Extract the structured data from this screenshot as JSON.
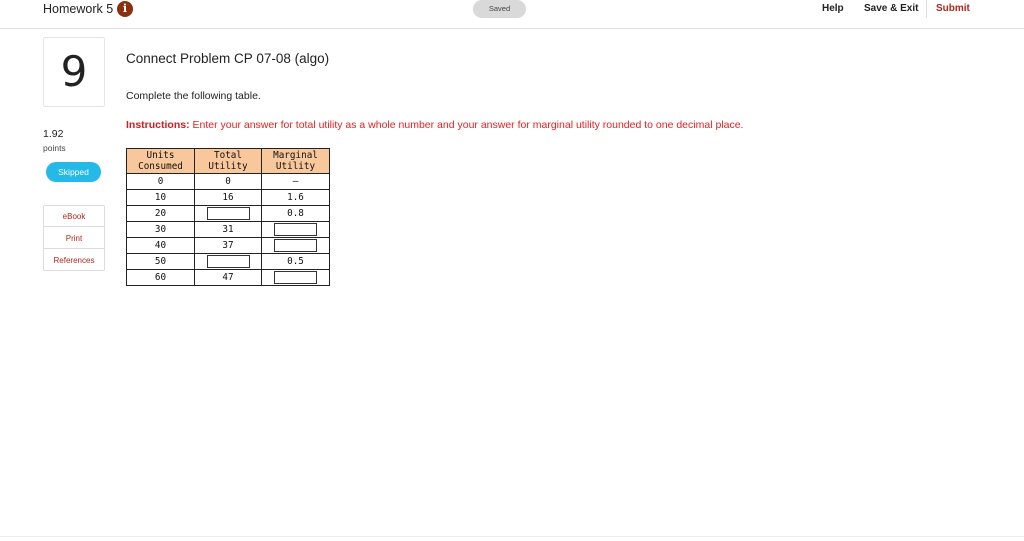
{
  "header": {
    "title": "Homework 5",
    "saved_label": "Saved",
    "help_label": "Help",
    "save_exit_label": "Save & Exit",
    "submit_label": "Submit",
    "info_icon": "info-icon"
  },
  "sidebar": {
    "question_number": "9",
    "points_value": "1.92",
    "points_label": "points",
    "status_label": "Skipped",
    "resources": [
      {
        "label": "eBook"
      },
      {
        "label": "Print"
      },
      {
        "label": "References"
      }
    ]
  },
  "problem": {
    "title": "Connect Problem CP 07-08 (algo)",
    "prompt": "Complete the following table.",
    "instructions_label": "Instructions:",
    "instructions_text": " Enter your answer for total utility as a whole number and your answer for marginal utility rounded to one decimal place."
  },
  "table": {
    "headers": [
      [
        "Units",
        "Consumed"
      ],
      [
        "Total",
        "Utility"
      ],
      [
        "Marginal",
        "Utility"
      ]
    ],
    "rows": [
      {
        "units": "0",
        "total": "0",
        "marginal": "–"
      },
      {
        "units": "10",
        "total": "16",
        "marginal": "1.6"
      },
      {
        "units": "20",
        "total": "",
        "marginal": "0.8"
      },
      {
        "units": "30",
        "total": "31",
        "marginal": ""
      },
      {
        "units": "40",
        "total": "37",
        "marginal": ""
      },
      {
        "units": "50",
        "total": "",
        "marginal": "0.5"
      },
      {
        "units": "60",
        "total": "47",
        "marginal": ""
      }
    ],
    "input_cells": {
      "total": [
        2,
        5
      ],
      "marginal": [
        3,
        4,
        6
      ]
    }
  },
  "colors": {
    "header_fill": "#f8c79b",
    "accent_red": "#b3261e",
    "instruction_red": "#e8201f",
    "skipped_blue": "#26b8e7",
    "info_brown": "#8b2f0e"
  }
}
